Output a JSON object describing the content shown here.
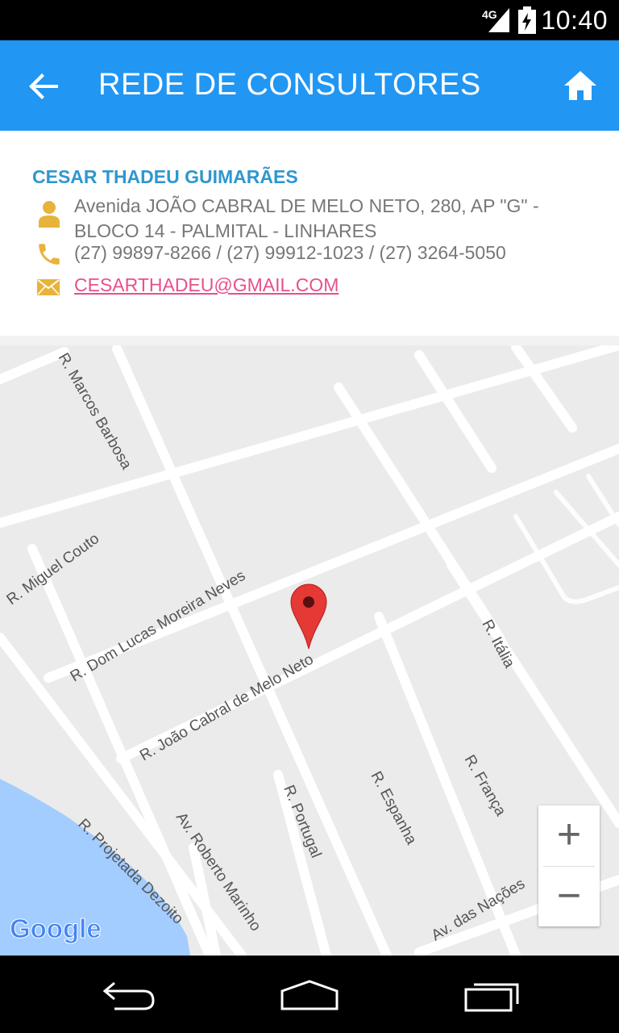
{
  "status_bar": {
    "network": "4G",
    "time": "10:40"
  },
  "app_bar": {
    "title": "REDE DE CONSULTORES",
    "back_icon": "arrow-left-icon",
    "home_icon": "home-icon"
  },
  "consultant": {
    "name": "CESAR THADEU GUIMARÃES",
    "address": "Avenida JOÃO CABRAL DE MELO NETO, 280, AP \"G\" - BLOCO 14 - PALMITAL - LINHARES",
    "phones": "(27) 99897-8266 / (27) 99912-1023 / (27) 3264-5050",
    "email": "CESARTHADEU@GMAIL.COM",
    "icon_color": "#e8b33a"
  },
  "map": {
    "streets": {
      "marcos_barbosa": "R. Marcos Barbosa",
      "miguel_couto": "R. Miguel Couto",
      "dom_lucas": "R. Dom Lucas Moreira Neves",
      "joao_cabral": "R. João Cabral de Melo Neto",
      "italia": "R. Itália",
      "franca": "R. França",
      "espanha": "R. Espanha",
      "portugal": "R. Portugal",
      "roberto_marinho": "Av. Roberto Marinho",
      "projetada": "R. Projetada Dezoito",
      "nacoes": "Av. das Nações"
    },
    "attribution": "Google",
    "zoom_in": "+",
    "zoom_out": "−",
    "marker_color": "#e53935",
    "water_color": "#a3ccff"
  },
  "nav_bar": {
    "back": "nav-back-icon",
    "home": "nav-home-icon",
    "recents": "nav-recents-icon"
  }
}
